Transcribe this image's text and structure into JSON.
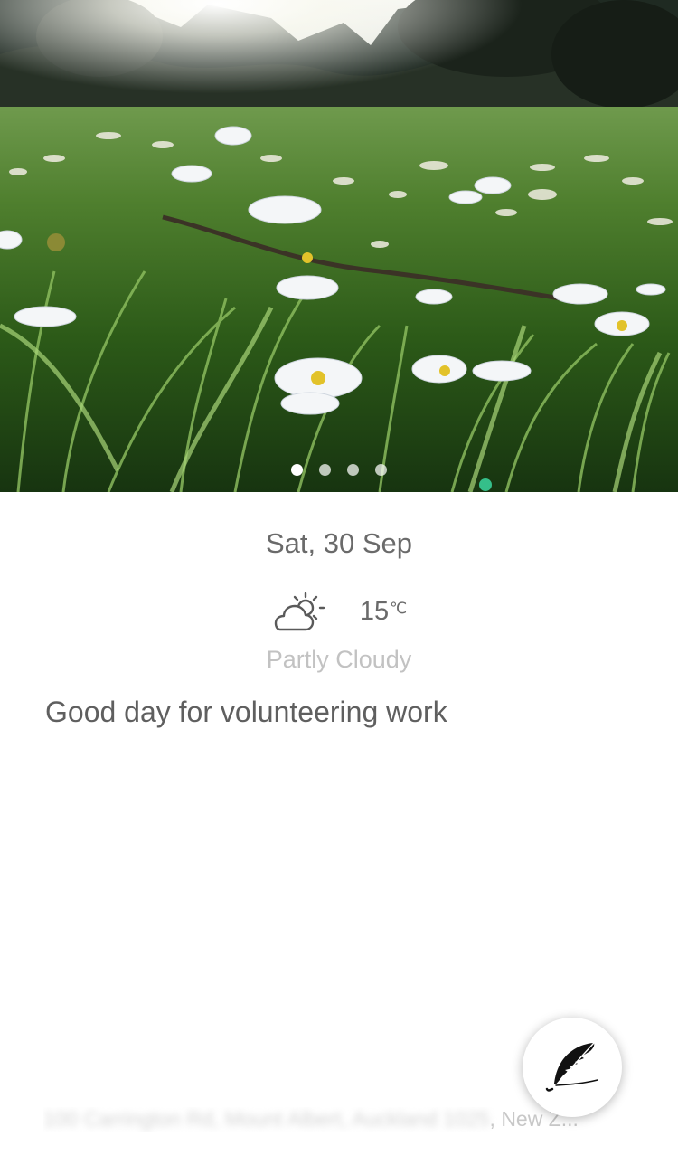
{
  "hero": {
    "page_count": 4,
    "active_page": 0
  },
  "date": "Sat, 30 Sep",
  "weather": {
    "icon": "partly-cloudy-icon",
    "temperature": "15",
    "unit": "℃",
    "condition": "Partly Cloudy"
  },
  "message": "Good day for volunteering work",
  "location": {
    "obscured": "100 Carrington Rd, Mount Albert, Auckland 1025",
    "visible_tail": ", New Z..."
  },
  "compose_button": {
    "icon": "feather-icon"
  }
}
